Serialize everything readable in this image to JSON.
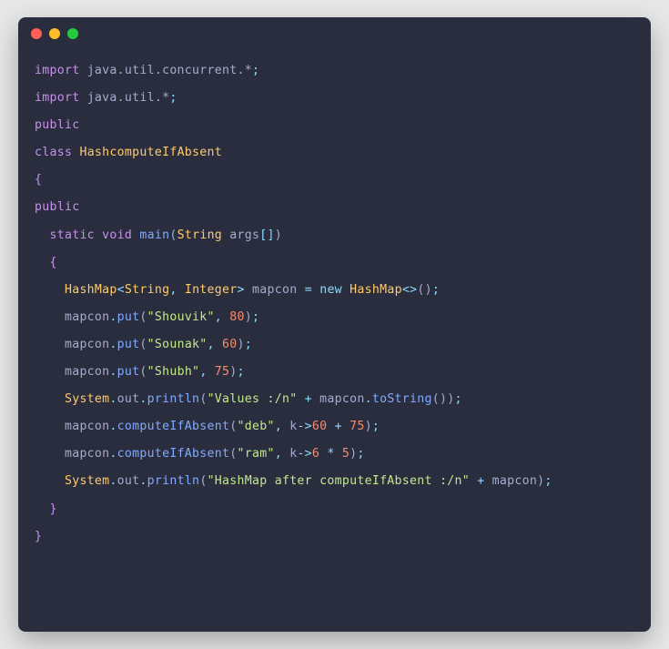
{
  "code": {
    "line1": {
      "import": "import",
      "pkg": "java.util.concurrent.*",
      "semi": ";"
    },
    "line2": {
      "import": "import",
      "pkg": "java.util.*",
      "semi": ";"
    },
    "line3": {
      "public": "public"
    },
    "line4": {
      "class": "class",
      "name": "HashcomputeIfAbsent"
    },
    "line5": {
      "brace": "{"
    },
    "line6": {
      "public": "public"
    },
    "line7": {
      "static": "static",
      "void": "void",
      "main": "main",
      "lparen": "(",
      "type": "String",
      "args": "args",
      "brackets": "[]",
      "rparen": ")"
    },
    "line8": {
      "brace": "{"
    },
    "line9": {
      "type1": "HashMap",
      "lt": "<",
      "gtype1": "String",
      "comma": ", ",
      "gtype2": "Integer",
      "gt": ">",
      "var": "mapcon",
      "eq": "=",
      "new": "new",
      "type2": "HashMap",
      "diamond": "<>",
      "parens": "()",
      "semi": ";"
    },
    "line10": {
      "obj": "mapcon",
      "dot": ".",
      "method": "put",
      "lparen": "(",
      "str": "\"Shouvik\"",
      "comma": ", ",
      "num": "80",
      "rparen": ")",
      "semi": ";"
    },
    "line11": {
      "obj": "mapcon",
      "dot": ".",
      "method": "put",
      "lparen": "(",
      "str": "\"Sounak\"",
      "comma": ", ",
      "num": "60",
      "rparen": ")",
      "semi": ";"
    },
    "line12": {
      "obj": "mapcon",
      "dot": ".",
      "method": "put",
      "lparen": "(",
      "str": "\"Shubh\"",
      "comma": ", ",
      "num": "75",
      "rparen": ")",
      "semi": ";"
    },
    "line13": {
      "sys": "System",
      "dot1": ".",
      "out": "out",
      "dot2": ".",
      "println": "println",
      "lparen": "(",
      "str": "\"Values :/n\"",
      "plus": " + ",
      "obj": "mapcon",
      "dot3": ".",
      "tostr": "toString",
      "parens": "()",
      "rparen": ")",
      "semi": ";"
    },
    "line14": {
      "obj": "mapcon",
      "dot": ".",
      "method": "computeIfAbsent",
      "lparen": "(",
      "str": "\"deb\"",
      "comma": ", ",
      "k": "k",
      "arrow": "->",
      "num1": "60",
      "plus": " + ",
      "num2": "75",
      "rparen": ")",
      "semi": ";"
    },
    "line15": {
      "obj": "mapcon",
      "dot": ".",
      "method": "computeIfAbsent",
      "lparen": "(",
      "str": "\"ram\"",
      "comma": ", ",
      "k": "k",
      "arrow": "->",
      "num1": "6",
      "mult": " * ",
      "num2": "5",
      "rparen": ")",
      "semi": ";"
    },
    "line16": {
      "sys": "System",
      "dot1": ".",
      "out": "out",
      "dot2": ".",
      "println": "println",
      "lparen": "(",
      "str": "\"HashMap after computeIfAbsent :/n\"",
      "plus": " + ",
      "obj": "mapcon",
      "rparen": ")",
      "semi": ";"
    },
    "line17": {
      "brace": "}"
    },
    "line18": {
      "brace": "}"
    }
  }
}
